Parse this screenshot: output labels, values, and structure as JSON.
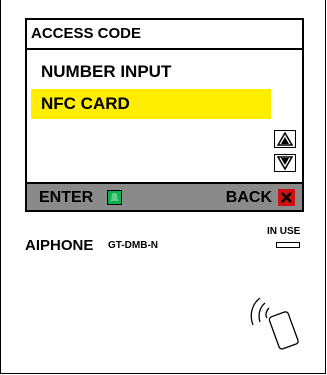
{
  "screen": {
    "title": "ACCESS CODE",
    "menu_items": [
      {
        "label": "NUMBER INPUT",
        "selected": false
      },
      {
        "label": "NFC CARD",
        "selected": true
      }
    ],
    "highlight_color": "#ffee00",
    "footer": {
      "enter_label": "ENTER",
      "enter_color": "#10b050",
      "back_label": "BACK",
      "back_color": "#d01010",
      "bar_color": "#8a8a8a"
    },
    "icons": {
      "up": "up-arrow-icon",
      "down": "down-arrow-icon"
    }
  },
  "device": {
    "brand": "AIPHONE",
    "model": "GT-DMB-N",
    "in_use_label": "IN USE",
    "nfc_icon": "nfc-reader-icon"
  }
}
